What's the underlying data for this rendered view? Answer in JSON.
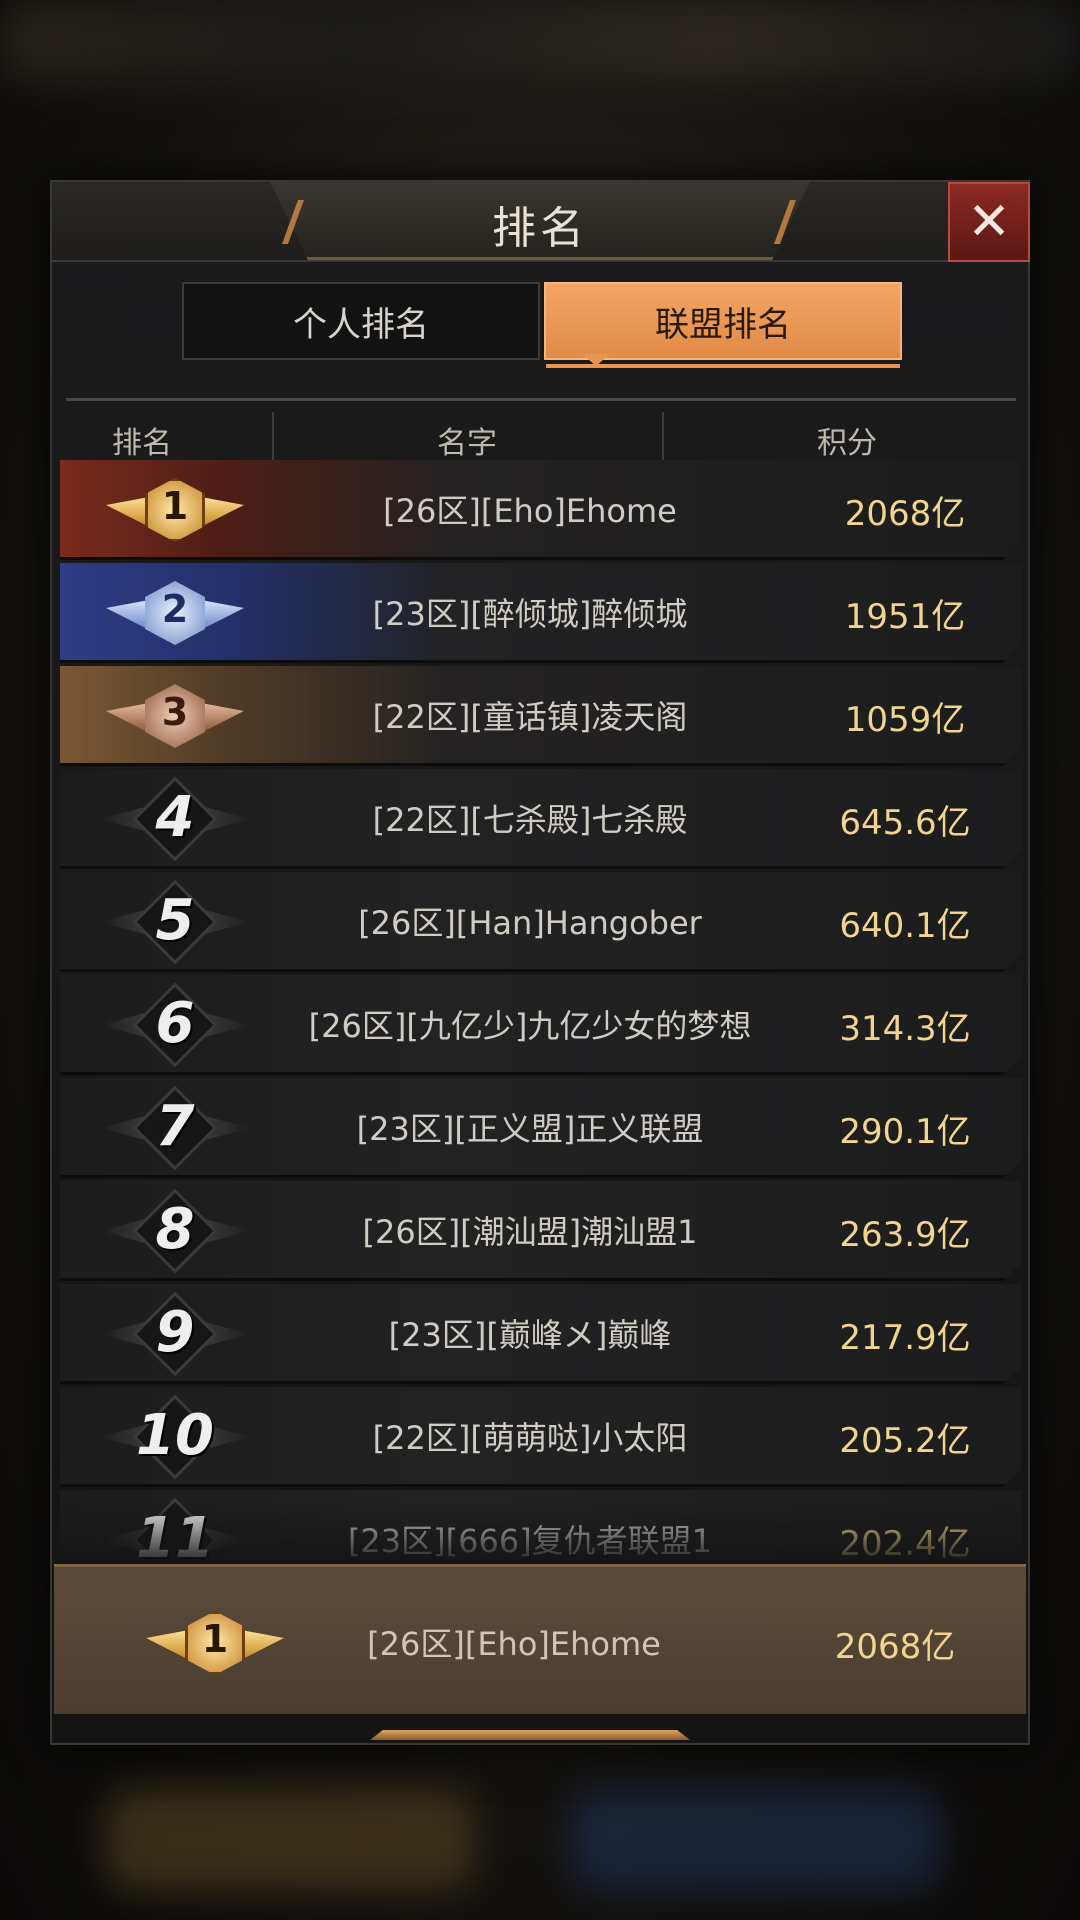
{
  "title": "排名",
  "close_icon": "close-icon",
  "tabs": [
    {
      "label": "个人排名",
      "active": false
    },
    {
      "label": "联盟排名",
      "active": true
    }
  ],
  "columns": {
    "rank": "排名",
    "name": "名字",
    "score": "积分"
  },
  "rows": [
    {
      "rank": "1",
      "name": "[26区][Eho]Ehome",
      "score": "2068亿",
      "medal": "gold"
    },
    {
      "rank": "2",
      "name": "[23区][醉倾城]醉倾城",
      "score": "1951亿",
      "medal": "silver"
    },
    {
      "rank": "3",
      "name": "[22区][童话镇]凌天阁",
      "score": "1059亿",
      "medal": "bronze"
    },
    {
      "rank": "4",
      "name": "[22区][七杀殿]七杀殿",
      "score": "645.6亿"
    },
    {
      "rank": "5",
      "name": "[26区][Han]Hangober",
      "score": "640.1亿"
    },
    {
      "rank": "6",
      "name": "[26区][九亿少]九亿少女的梦想",
      "score": "314.3亿"
    },
    {
      "rank": "7",
      "name": "[23区][正义盟]正义联盟",
      "score": "290.1亿"
    },
    {
      "rank": "8",
      "name": "[26区][潮汕盟]潮汕盟1",
      "score": "263.9亿"
    },
    {
      "rank": "9",
      "name": "[23区][巅峰メ]巅峰",
      "score": "217.9亿"
    },
    {
      "rank": "10",
      "name": "[22区][萌萌哒]小太阳",
      "score": "205.2亿"
    },
    {
      "rank": "11",
      "name": "[23区][666]复仇者联盟1",
      "score": "202.4亿"
    }
  ],
  "my_entry": {
    "rank": "1",
    "name": "[26区][Eho]Ehome",
    "score": "2068亿",
    "medal": "gold"
  },
  "colors": {
    "accent": "#e9954f",
    "score": "#f1d58e",
    "close": "#8c2a24"
  }
}
